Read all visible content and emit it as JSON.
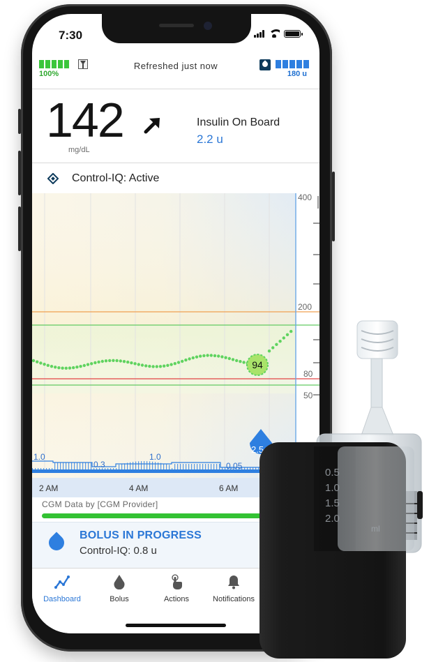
{
  "status_bar": {
    "time": "7:30"
  },
  "pump_status": {
    "battery_label": "100%",
    "refresh_text": "Refreshed just now",
    "insulin_label": "180 u",
    "battery_fraction": 1.0,
    "insulin_fraction": 1.0
  },
  "glucose": {
    "value": "142",
    "unit": "mg/dL",
    "trend_icon": "arrow-up-right-icon"
  },
  "iob": {
    "title": "Insulin On Board",
    "value": "2.2 u"
  },
  "control_iq": {
    "label": "Control-IQ: Active"
  },
  "chart_data": {
    "type": "line",
    "y_ticks": [
      "400",
      "200",
      "80",
      "50"
    ],
    "x_ticks": [
      "2 AM",
      "4 AM",
      "6 AM"
    ],
    "high_line": 200,
    "low_line": 80,
    "target_range": [
      70,
      180
    ],
    "current_point_label": "94",
    "bolus_marker_label": "2.5",
    "insulin_labels": [
      "1.0",
      "0.3",
      "1.0",
      "0.05"
    ],
    "colors": {
      "cgm": "#5fd35f",
      "high": "#f0a050",
      "low": "#e24444",
      "target": "#62c962",
      "basal": "#2e7fe0"
    }
  },
  "cgm_provider": "CGM Data by [CGM Provider]",
  "bolus": {
    "title": "BOLUS IN PROGRESS",
    "subtitle": "Control-IQ: 0.8 u"
  },
  "nav": {
    "items": [
      {
        "label": "Dashboard",
        "icon": "dashboard-icon",
        "active": true
      },
      {
        "label": "Bolus",
        "icon": "drop-icon"
      },
      {
        "label": "Actions",
        "icon": "tap-hand-icon"
      },
      {
        "label": "Notifications",
        "icon": "bell-icon"
      }
    ]
  },
  "device": {
    "scale_labels": [
      "0.5",
      "1.0",
      "1.5",
      "2.0"
    ],
    "scale_unit": "ml"
  }
}
